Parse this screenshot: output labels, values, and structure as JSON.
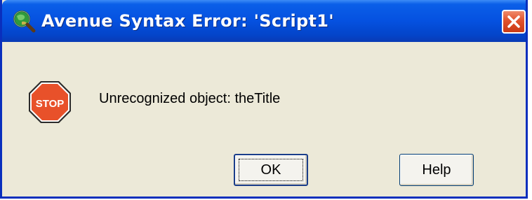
{
  "window": {
    "title": "Avenue Syntax Error: 'Script1'",
    "title_icon": "arcview-globe-magnifier-icon",
    "close_icon": "close-icon"
  },
  "dialog": {
    "icon": "stop-icon",
    "icon_label": "STOP",
    "message": "Unrecognized object: theTitle"
  },
  "buttons": {
    "ok_label": "OK",
    "help_label": "Help"
  },
  "colors": {
    "titlebar": "#0551e0",
    "close_button": "#e1522c",
    "stop_sign": "#e8512a",
    "dialog_background": "#ece9d8"
  }
}
